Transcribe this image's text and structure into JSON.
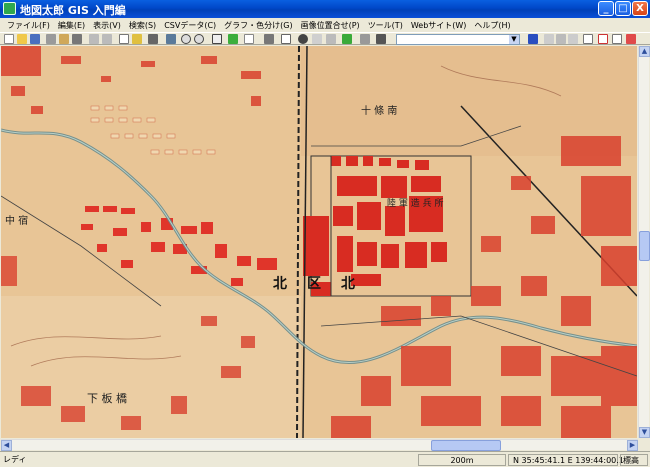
{
  "window": {
    "title": "地図太郎 GIS 入門編",
    "min_glyph": "_",
    "max_glyph": "□",
    "close_glyph": "X"
  },
  "menu": {
    "items": [
      {
        "label": "ファイル(F)",
        "name": "menu-file"
      },
      {
        "label": "編集(E)",
        "name": "menu-edit"
      },
      {
        "label": "表示(V)",
        "name": "menu-view"
      },
      {
        "label": "検索(S)",
        "name": "menu-search"
      },
      {
        "label": "CSVデータ(C)",
        "name": "menu-csv"
      },
      {
        "label": "グラフ・色分け(G)",
        "name": "menu-graph"
      },
      {
        "label": "画像位置合せ(P)",
        "name": "menu-image-align"
      },
      {
        "label": "ツール(T)",
        "name": "menu-tools"
      },
      {
        "label": "Webサイト(W)",
        "name": "menu-website"
      },
      {
        "label": "ヘルプ(H)",
        "name": "menu-help"
      }
    ]
  },
  "toolbar": {
    "combo_value": "",
    "combo_arrow": "▼"
  },
  "map": {
    "labels": {
      "kita": "北",
      "ku": "区",
      "kita_right": "北",
      "kanji_top": "十 條 南",
      "kanji_mid": "陸 軍 造 兵 所",
      "kanji_left": "下 板 橋",
      "kanji_left_top": "中 宿"
    }
  },
  "scroll": {
    "up": "▲",
    "down": "▼",
    "left": "◀",
    "right": "▶"
  },
  "status": {
    "ready": "レディ",
    "scale": "200m",
    "coords": "N 35:45:41.1  E 139:44:00.1",
    "elevation": "標高"
  }
}
